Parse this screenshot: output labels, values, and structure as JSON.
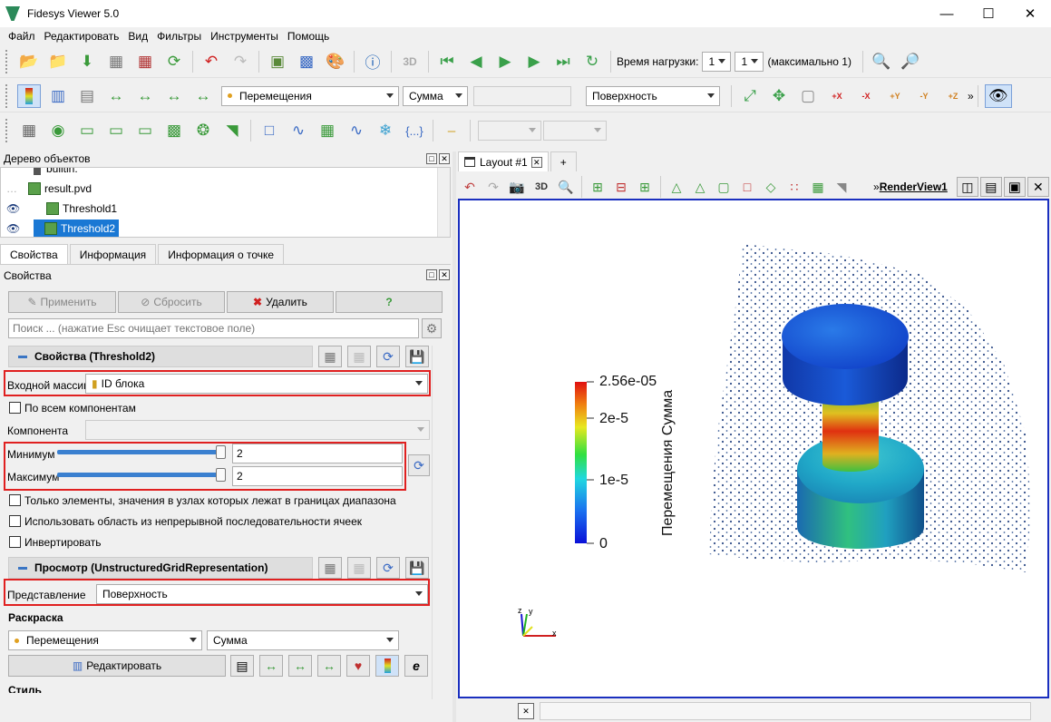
{
  "window": {
    "title": "Fidesys Viewer 5.0"
  },
  "menu": [
    "Файл",
    "Редактировать",
    "Вид",
    "Фильтры",
    "Инструменты",
    "Помощь"
  ],
  "toolbar1": {
    "time_label": "Время нагрузки:",
    "time_value": "1",
    "step_value": "1",
    "max_label": "(максимально 1)"
  },
  "toolbar2": {
    "array_value": "Перемещения",
    "component_value": "Сумма",
    "repr_value": "Поверхность",
    "axes": [
      "+X",
      "-X",
      "+Y",
      "-Y",
      "+Z"
    ]
  },
  "pipeline": {
    "header": "Дерево объектов",
    "items": [
      "builtin:",
      "result.pvd",
      "Threshold1",
      "Threshold2"
    ]
  },
  "tabs": [
    "Свойства",
    "Информация",
    "Информация о точке"
  ],
  "properties": {
    "header": "Свойства",
    "apply": "Применить",
    "reset": "Сбросить",
    "delete": "Удалить",
    "help": "?",
    "search_placeholder": "Поиск ... (нажатие Esc очищает текстовое поле)",
    "section_props": "Свойства (Threshold2)",
    "input_array_label": "Входной массив",
    "input_array_value": "ID блока",
    "all_components": "По всем компонентам",
    "component_label": "Компонента",
    "min_label": "Минимум",
    "min_value": "2",
    "max_label": "Максимум",
    "max_value": "2",
    "only_elements": "Только элементы, значения в узлах которых лежат в границах диапазона",
    "use_continuous": "Использовать область из непрерывной последовательности ячеек",
    "invert": "Инвертировать",
    "section_view": "Просмотр (UnstructuredGridRepresentation)",
    "representation_label": "Представление",
    "representation_value": "Поверхность",
    "coloring_label": "Раскраска",
    "coloring_array": "Перемещения",
    "coloring_component": "Сумма",
    "edit_button": "Редактировать",
    "style_label": "Стиль"
  },
  "layout": {
    "tab": "Layout #1",
    "plus": "+",
    "view3d": "3D",
    "renderview": "RenderView1"
  },
  "colorbar": {
    "title": "Перемещения Сумма",
    "ticks": [
      "2.56e-05",
      "2e-5",
      "1e-5",
      "0"
    ]
  },
  "axes_triad": {
    "x": "x",
    "y": "y",
    "z": "z"
  }
}
